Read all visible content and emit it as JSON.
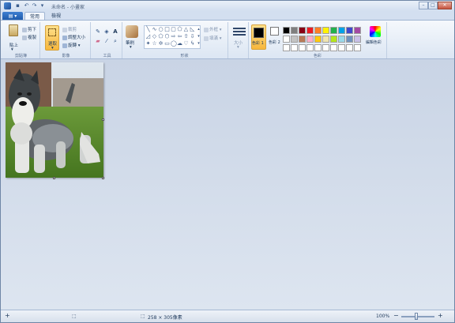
{
  "titlebar": {
    "title": "未命名 - 小畫家",
    "minimize": "–",
    "maximize": "□",
    "close": "✕"
  },
  "tabs": {
    "file": "▤ ▾",
    "items": [
      "常用",
      "檢視"
    ]
  },
  "ribbon": {
    "clipboard": {
      "label": "剪貼簿",
      "paste": "貼上",
      "cut": "剪下",
      "copy": "複製"
    },
    "image": {
      "label": "影像",
      "select": "選取",
      "crop": "裁剪",
      "resize": "調整大小",
      "rotate": "旋轉"
    },
    "tools": {
      "label": "工具",
      "text_tool": "A"
    },
    "brushes": {
      "label": "筆刷"
    },
    "shapes": {
      "label": "形狀",
      "outline": "外框",
      "fill": "填滿"
    },
    "size": {
      "label": "大小"
    },
    "colors": {
      "label": "色彩",
      "color1": "色彩 1",
      "color2": "色彩 2",
      "edit_colors": "編輯色彩",
      "palette_row1": [
        "#000000",
        "#7f7f7f",
        "#880015",
        "#ed1c24",
        "#ff7f27",
        "#fff200",
        "#22b14c",
        "#00a2e8",
        "#3f48cc",
        "#a349a4"
      ],
      "palette_row2": [
        "#ffffff",
        "#c3c3c3",
        "#b97a57",
        "#ffaec9",
        "#ffc90e",
        "#efe4b0",
        "#b5e61d",
        "#99d9ea",
        "#7092be",
        "#c8bfe7"
      ],
      "palette_row3": [
        "#ffffff",
        "#ffffff",
        "#ffffff",
        "#ffffff",
        "#ffffff",
        "#ffffff",
        "#ffffff",
        "#ffffff",
        "#ffffff",
        "#ffffff"
      ]
    }
  },
  "status": {
    "add": "+",
    "image_size": "258 × 305像素",
    "zoom": "100%",
    "zoom_out": "−",
    "zoom_in": "+"
  }
}
